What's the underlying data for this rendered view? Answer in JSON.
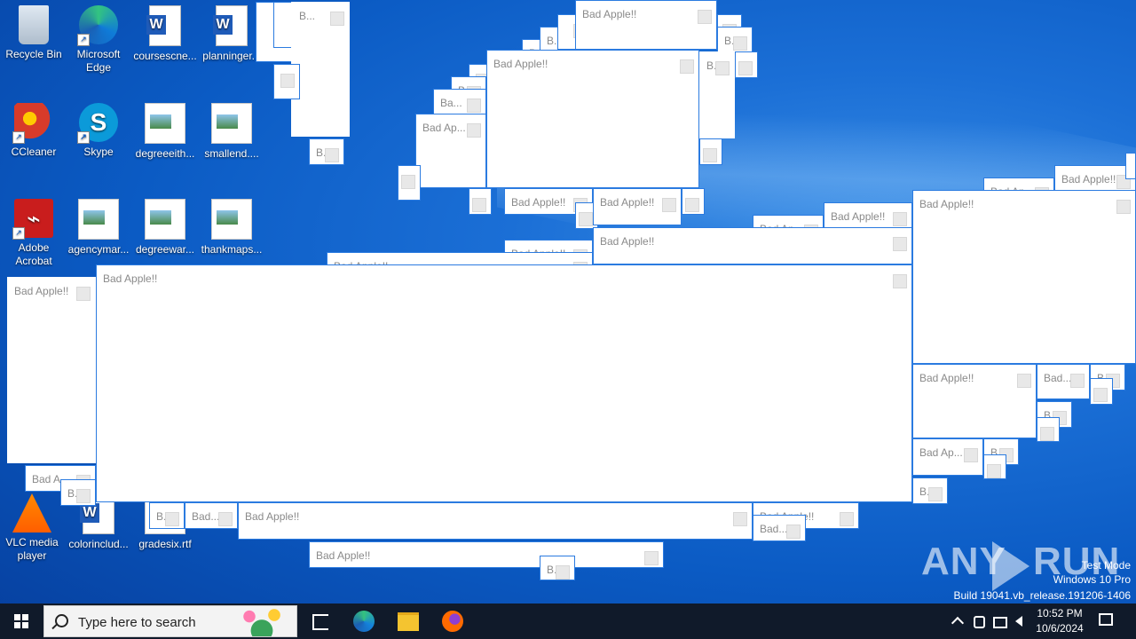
{
  "desktop_icons": {
    "recycle_bin": "Recycle Bin",
    "edge": "Microsoft Edge",
    "coursescne": "coursescne...",
    "planninger": "planninger...",
    "ccleaner": "CCleaner",
    "skype": "Skype",
    "degreeeith": "degreeeith...",
    "smallend": "smallend....",
    "acrobat": "Adobe Acrobat",
    "agencymar": "agencymar...",
    "degreewar": "degreewar...",
    "thankmaps": "thankmaps...",
    "vlc": "VLC media player",
    "colorinclud": "colorinclud...",
    "gradesix": "gradesix.rtf"
  },
  "popups": {
    "full": "Bad Apple!!",
    "short_ap": "Bad Ap...",
    "short_apple": "Bad Apple...",
    "short_bad": "Bad...",
    "short_a": "Bad A",
    "short_b": "B...",
    "short_bdot": "B.",
    "short_ba": "Ba..."
  },
  "taskbar": {
    "search_placeholder": "Type here to search",
    "time": "10:52 PM",
    "date": "10/6/2024"
  },
  "watermark": {
    "brand": "ANY",
    "brand2": "RUN",
    "line1": "Test Mode",
    "line2": "Windows 10 Pro",
    "line3": "Build 19041.vb_release.191206-1406"
  }
}
